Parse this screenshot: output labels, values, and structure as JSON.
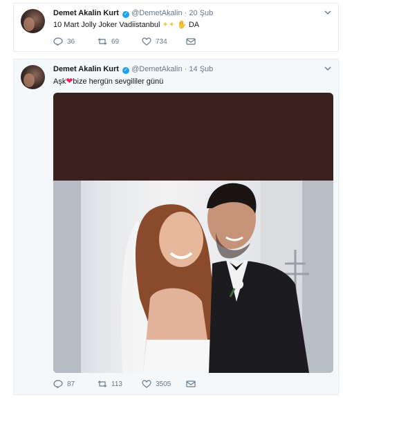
{
  "tweets": [
    {
      "author": "Demet Akalin Kurt",
      "handle": "@DemetAkalin",
      "separator": "·",
      "date": "20 Şub",
      "text_main": "10 Mart Jolly Joker Vadiistanbul",
      "text_suffix": "DA",
      "replies": "36",
      "retweets": "69",
      "likes": "734"
    },
    {
      "author": "Demet Akalin Kurt",
      "handle": "@DemetAkalin",
      "separator": "·",
      "date": "14 Şub",
      "text_prefix": "Aşk",
      "text_suffix": "bize hergün sevgililer günü",
      "replies": "87",
      "retweets": "113",
      "likes": "3505"
    }
  ],
  "colors": {
    "verified": "#1da1f2",
    "heart": "#e0245e",
    "muted": "#657786"
  }
}
